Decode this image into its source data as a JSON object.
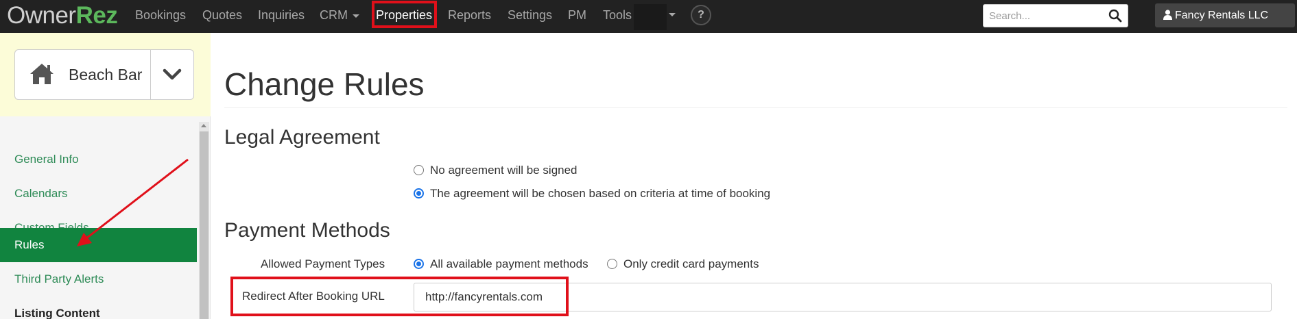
{
  "brand": {
    "owner": "Owner",
    "rez": "Rez"
  },
  "nav": {
    "items": [
      {
        "label": "Bookings"
      },
      {
        "label": "Quotes"
      },
      {
        "label": "Inquiries"
      },
      {
        "label": "CRM"
      },
      {
        "label": "Properties"
      },
      {
        "label": "Reports"
      },
      {
        "label": "Settings"
      },
      {
        "label": "PM"
      },
      {
        "label": "Tools"
      }
    ],
    "help_label": "?",
    "search_placeholder": "Search...",
    "account_label": "Fancy Rentals LLC"
  },
  "sidebar": {
    "property_name": "Beach Bar",
    "items": [
      {
        "label": "General Info"
      },
      {
        "label": "Calendars"
      },
      {
        "label": "Custom Fields"
      },
      {
        "label": "Rules"
      },
      {
        "label": "Third Party Alerts"
      },
      {
        "label": "Listing Content"
      }
    ],
    "active_item": "Rules"
  },
  "main": {
    "title": "Change Rules",
    "legal": {
      "title": "Legal Agreement",
      "options": [
        {
          "label": "No agreement will be signed",
          "checked": false
        },
        {
          "label": "The agreement will be chosen based on criteria at time of booking",
          "checked": true
        }
      ]
    },
    "payment": {
      "title": "Payment Methods",
      "allowed_label": "Allowed Payment Types",
      "options": [
        {
          "label": "All available payment methods",
          "checked": true
        },
        {
          "label": "Only credit card payments",
          "checked": false
        }
      ],
      "redirect_label": "Redirect After Booking URL",
      "redirect_value": "http://fancyrentals.com"
    }
  },
  "colors": {
    "nav_bg": "#222222",
    "brand_accent": "#5cb85c",
    "sidebar_active": "#11843f",
    "sidebar_link": "#2e8b57",
    "highlight": "#e0101a",
    "radio_accent": "#1a73e8"
  },
  "icons": {
    "search": "search-icon",
    "user": "user-icon",
    "home": "home-icon",
    "dropdown": "chevron-down-icon"
  }
}
